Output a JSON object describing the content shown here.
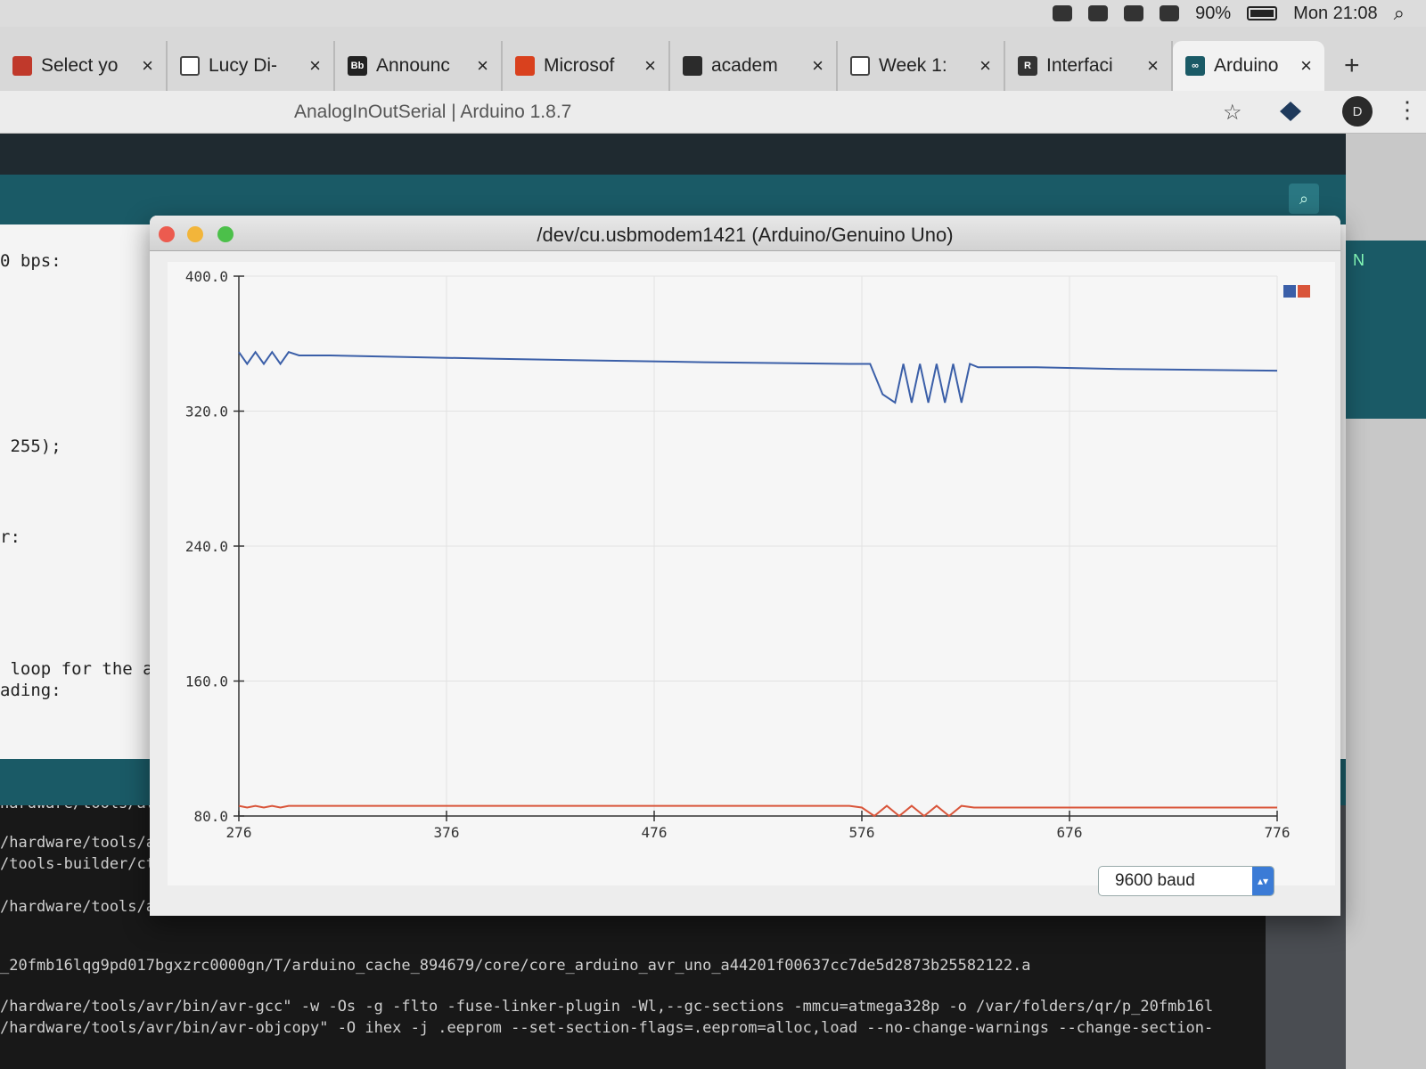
{
  "menubar": {
    "battery": "90%",
    "clock": "Mon 21:08"
  },
  "tabs": [
    {
      "title": "Select yo",
      "fav_color": "#c0392b",
      "fav_glyph": ""
    },
    {
      "title": "Lucy Di-",
      "fav_color": "#ffffff",
      "fav_glyph": ""
    },
    {
      "title": "Announc",
      "fav_color": "#222222",
      "fav_glyph": "Bb"
    },
    {
      "title": "Microsof",
      "fav_color": "#d9411e",
      "fav_glyph": ""
    },
    {
      "title": "academ",
      "fav_color": "#2b2b2b",
      "fav_glyph": ""
    },
    {
      "title": "Week 1:",
      "fav_color": "#ffffff",
      "fav_glyph": ""
    },
    {
      "title": "Interfaci",
      "fav_color": "#333333",
      "fav_glyph": "R"
    },
    {
      "title": "Arduino",
      "fav_color": "#1a5a66",
      "fav_glyph": "∞",
      "active": true
    }
  ],
  "tab_close": "×",
  "new_tab": "+",
  "window": {
    "title": "AnalogInOutSerial | Arduino 1.8.7",
    "avatar_letter": "D",
    "chevrons": "»",
    "side_label": "N"
  },
  "editor_lines": [
    "0 bps:",
    " 255);",
    "r:",
    " loop for the ana",
    "ading:"
  ],
  "console_lines": [
    "hardware/tools/av",
    "/hardware/tools/av",
    "/tools-builder/ctd",
    "/hardware/tools/avr/bin/avr-g++\" -c -g -Os -w -std=gnu++11 -fpermissive -fno-exceptions -ffunction-sections -fdata-sections -fno-thre",
    "_20fmb16lqg9pd017bgxzrc0000gn/T/arduino_cache_894679/core/core_arduino_avr_uno_a44201f00637cc7de5d2873b25582122.a",
    "/hardware/tools/avr/bin/avr-gcc\" -w -Os -g -flto -fuse-linker-plugin -Wl,--gc-sections -mmcu=atmega328p -o /var/folders/qr/p_20fmb16l",
    "/hardware/tools/avr/bin/avr-objcopy\" -O ihex -j .eeprom --set-section-flags=.eeprom=alloc,load --no-change-warnings --change-section-"
  ],
  "plotter": {
    "title": "/dev/cu.usbmodem1421 (Arduino/Genuino Uno)",
    "baud": "9600 baud",
    "colors": {
      "series1": "#3b5fa8",
      "series2": "#d9553a"
    }
  },
  "chart_data": {
    "type": "line",
    "title": "",
    "xlabel": "",
    "ylabel": "",
    "xlim": [
      276,
      776
    ],
    "ylim": [
      80,
      400
    ],
    "x_ticks": [
      276,
      376,
      476,
      576,
      676,
      776
    ],
    "y_ticks": [
      400.0,
      320.0,
      240.0,
      160.0,
      80.0
    ],
    "y_tick_labels": [
      "400.0",
      "320.0",
      "240.0",
      "160.0",
      "80.0"
    ],
    "legend": "top-right",
    "series": [
      {
        "color": "#3b5fa8",
        "x": [
          276,
          280,
          284,
          288,
          292,
          296,
          300,
          305,
          320,
          400,
          500,
          570,
          580,
          586,
          592,
          596,
          600,
          604,
          608,
          612,
          616,
          620,
          624,
          628,
          632,
          640,
          660,
          700,
          776
        ],
        "y": [
          355,
          348,
          355,
          348,
          355,
          348,
          355,
          353,
          353,
          351,
          349,
          348,
          348,
          330,
          325,
          348,
          325,
          348,
          325,
          348,
          325,
          348,
          325,
          348,
          346,
          346,
          346,
          345,
          344
        ]
      },
      {
        "color": "#d9553a",
        "x": [
          276,
          280,
          284,
          288,
          292,
          296,
          300,
          400,
          500,
          570,
          576,
          582,
          588,
          594,
          600,
          606,
          612,
          618,
          624,
          630,
          640,
          700,
          776
        ],
        "y": [
          86,
          85,
          86,
          85,
          86,
          85,
          86,
          86,
          86,
          86,
          85,
          80,
          86,
          80,
          86,
          80,
          86,
          80,
          86,
          85,
          85,
          85,
          85
        ]
      }
    ]
  }
}
